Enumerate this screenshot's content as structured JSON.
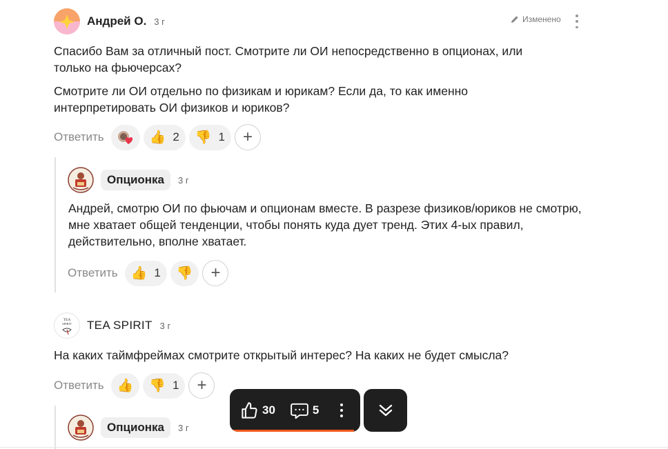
{
  "comments": [
    {
      "author": "Андрей О.",
      "time": "3 г",
      "edited": "Изменено",
      "paragraphs": [
        "Спасибо Вам за отличный пост. Смотрите ли ОИ непосредственно в опционах, или только на фьючерсах?",
        "Смотрите ли ОИ отдельно по физикам и юрикам? Если да, то как именно интерпретировать ОИ физиков и юриков?"
      ],
      "reply_label": "Ответить",
      "likes": "2",
      "dislikes": "1",
      "add_label": "+"
    },
    {
      "author": "Опционка",
      "time": "3 г",
      "paragraphs": [
        "Андрей, смотрю ОИ по фьючам и опционам вместе. В разрезе физиков/юриков не смотрю, мне хватает общей тенденции, чтобы понять куда дует тренд. Этих 4-ых правил, действительно, вполне хватает."
      ],
      "reply_label": "Ответить",
      "likes": "1",
      "add_label": "+"
    },
    {
      "author": "TEA SPIRIT",
      "time": "3 г",
      "avatar_text": "TEA SPIRIT",
      "paragraphs": [
        "На каких таймфреймах смотрите открытый интерес? На каких не будет смысла?"
      ],
      "reply_label": "Ответить",
      "dislikes": "1",
      "add_label": "+"
    },
    {
      "author": "Опционка",
      "time": "3 г"
    }
  ],
  "toolbar": {
    "likes": "30",
    "comments": "5"
  },
  "icons": {
    "thumbs_up": "👍",
    "thumbs_down": "👎",
    "accent": "#f0581c"
  }
}
